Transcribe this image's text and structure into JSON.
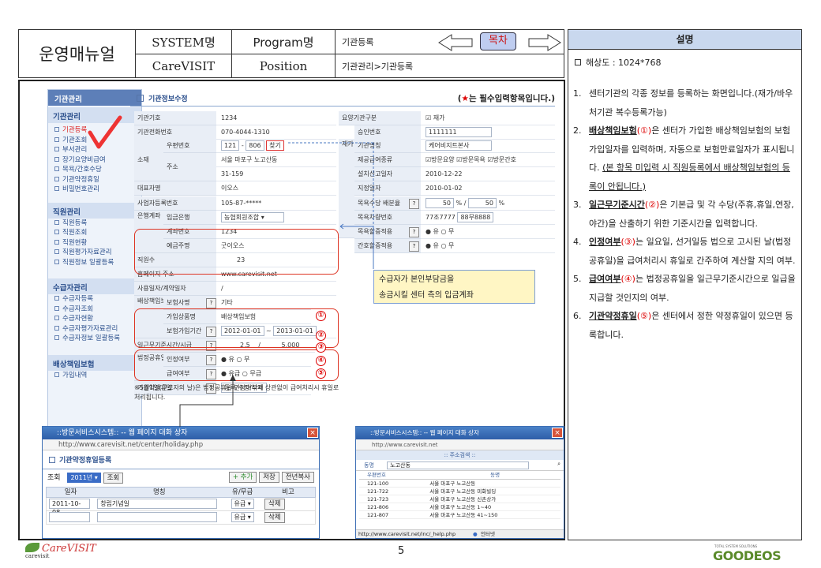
{
  "header": {
    "title": "운영매뉴얼",
    "system_label": "SYSTEM명",
    "system_value": "CareVISIT",
    "program_label": "Program명",
    "position_label": "Position",
    "program_value": "기관등록",
    "position_value": "기관관리>기관등록",
    "toc_button": "목차"
  },
  "desc": {
    "title": "설명",
    "resolution": "해상도 : 1024*768",
    "items": [
      {
        "num": "1.",
        "text": "센터기관의 각종 정보를 등록하는 화면입니다.(재가/바우처기관 복수등록가능)"
      },
      {
        "num": "2.",
        "key": "배상책임보험",
        "mark": "①",
        "text": "은 센터가 가입한 배상책임보험의 보험가입일자를 입력하며, 자동으로 보험만료일자가 표시됩니다. ",
        "under": "(본 항목 미입력 시 직원등록에서 배상책임보험의 등록이 안됩니다.)"
      },
      {
        "num": "3.",
        "key": "일근무기준시간",
        "mark": "②",
        "text": "은 기본급 및 각 수당(주휴,휴일,연장,야간)을 산출하기 위한 기준시간을 입력합니다."
      },
      {
        "num": "4.",
        "key": "인정여부",
        "mark": "③",
        "text": "는 일요일, 선거일등 법으로 고시된 날(법정공휴일)을 급여처리시 휴일로 간주하여 계산할 지의 여부."
      },
      {
        "num": "5.",
        "key": "급여여부",
        "mark": "④",
        "text": "는 법정공휴일을 일근무기준시간으로 일급을 지급할 것인지의 여부."
      },
      {
        "num": "6.",
        "key": "기관약정휴일",
        "mark": "⑤",
        "text": "은 센터에서 정한 약정휴일이 있으면 등록합니다."
      }
    ]
  },
  "sidebar": {
    "sections": [
      {
        "title": "기관관리",
        "sub": "기관관리",
        "items": [
          "기관등록",
          "기관조회",
          "부서관리",
          "장기요양비급여",
          "목욕/간호수당",
          "기관약정휴일",
          "비밀번호관리"
        ]
      },
      {
        "title": "직원관리",
        "items": [
          "직원등록",
          "직원조회",
          "직원현황",
          "직원평가자료관리",
          "직원정보 일괄등록"
        ]
      },
      {
        "title": "수급자관리",
        "items": [
          "수급자등록",
          "수급자조회",
          "수급자현황",
          "수급자평가자료관리",
          "수급자정보 일괄등록"
        ]
      },
      {
        "title": "배상책임보험",
        "items": [
          "가입내역"
        ]
      }
    ],
    "header_label": "기관관리"
  },
  "form": {
    "section_title": "기관정보수정",
    "required_note": "는 필수입력항목입니다.)",
    "required_open": "(",
    "required_star": "★",
    "labels": {
      "code": "기관기호",
      "tel": "기관전화번호",
      "location": "소재",
      "zip": "우편번호",
      "addr": "주소",
      "rep": "대표자명",
      "bizno": "사업자등록번호",
      "bank_group": "은행계좌",
      "bank": "입금은행",
      "account": "계좌번호",
      "holder": "예금주명",
      "staff": "직원수",
      "homepage": "홈페이지 주소",
      "contract": "사용일자/계약일자",
      "insurance_group": "배상책임보험",
      "ins_company": "보험사명",
      "ins_product": "가입상품명",
      "ins_date": "보험가입기간",
      "work_hours": "일근무기준시간/시급",
      "holiday_group": "법정공휴일",
      "recognize": "인정여부",
      "pay": "급여여부",
      "agreed_holiday": "기관약정휴일",
      "care_type": "요양기관구분",
      "approval": "승인번호",
      "facility": "기관명칭",
      "service": "제공급여종류",
      "install_date": "설치신고일자",
      "designate_date": "지정일자",
      "bath_ratio": "목욕수당 배분율",
      "bath_car": "목욕차량번호",
      "bath_apply": "목욕할증적용",
      "nurse_apply": "간호할증적용",
      "side_label": "재가"
    },
    "values": {
      "code": "1234",
      "tel": "070-4044-1310",
      "zip1": "121",
      "zip_sep": "-",
      "zip2": "806",
      "zip_btn": "찾기",
      "addr1": "서울 마포구 노고산동",
      "addr2": "31-159",
      "rep": "이오스",
      "bizno": "105-87-*****",
      "bank": "농협회원조합",
      "account": "1234",
      "holder": "굿이오스",
      "staff": "23",
      "homepage": "www.carevisit.net",
      "contract": "/",
      "ins_company": "기타",
      "ins_product": "배상책임보험",
      "ins_from": "2012-01-01",
      "ins_sep": "~",
      "ins_to": "2013-01-01",
      "work_hours": "2.5",
      "slash": "/",
      "wage": "5,000",
      "yes": "유",
      "no": "무",
      "pay_yes": "유급",
      "pay_no": "무급",
      "agreed_btn": "등록/수정/삭제",
      "care_type": "재가",
      "approval": "1111111",
      "facility": "케어비지트본사",
      "service1": "방문요양",
      "service2": "방문목욕",
      "service3": "방문간호",
      "install_date": "2010-12-22",
      "designate_date": "2010-01-02",
      "ratio1": "50",
      "ratio2": "50",
      "pct": "%",
      "ratio_sep": "/",
      "car1": "77조7777",
      "car2": "88무8888",
      "q": "?"
    },
    "footnote": "※5월1일(근로자의 날)은 법정공휴일 인정여부와 상관없이 급여처리시 휴일로 처리됩니다.",
    "marks": [
      "①",
      "②",
      "③",
      "④",
      "⑤"
    ],
    "callout": [
      "수급자가 본인부담금을",
      "송금시킬 센터 측의 입금계좌"
    ]
  },
  "popup1": {
    "title": "::방문서비스시스템:: -- 웹 페이지 대화 상자",
    "url": "http://www.carevisit.net/center/holiday.php",
    "heading": "기관약정휴일등록",
    "search_label": "조회",
    "year": "2011년",
    "search_btn": "조회",
    "add_btn": "+ 추가",
    "save_btn": "저장",
    "copy_btn": "전년복사",
    "columns": [
      "일자",
      "명칭",
      "유/무급",
      "비고"
    ],
    "rows": [
      {
        "date": "2011-10-08",
        "name": "창립기념일",
        "pay": "유급",
        "action": "삭제"
      },
      {
        "date": "",
        "name": "",
        "pay": "유급",
        "action": "삭제"
      }
    ]
  },
  "popup2": {
    "title": "::방문서비스시스템:: -- 웹 페이지 대화 상자",
    "url": "http://www.carevisit.net",
    "subtitle": ":: 주소검색 ::",
    "search_label": "동명",
    "search_value": "노고산동",
    "columns": [
      "우편번호",
      "동명"
    ],
    "rows": [
      [
        "121-100",
        "서울 마포구 노고산동"
      ],
      [
        "121-722",
        "서울 마포구 노고산동 미화빌딩"
      ],
      [
        "121-723",
        "서울 마포구 노고산동 신촌상가"
      ],
      [
        "121-806",
        "서울 마포구 노고산동 1~40"
      ],
      [
        "121-807",
        "서울 마포구 노고산동 41~150"
      ]
    ],
    "status_url": "http://www.carevisit.net/inc/_help.php",
    "status_zone": "인터넷"
  },
  "footer": {
    "logo": "CareVISIT",
    "logo_sub": "carevisit",
    "page": "5",
    "brand": "GOODEOS",
    "brand_tag": "TOTAL SYSTEM SOLUTIONS"
  }
}
